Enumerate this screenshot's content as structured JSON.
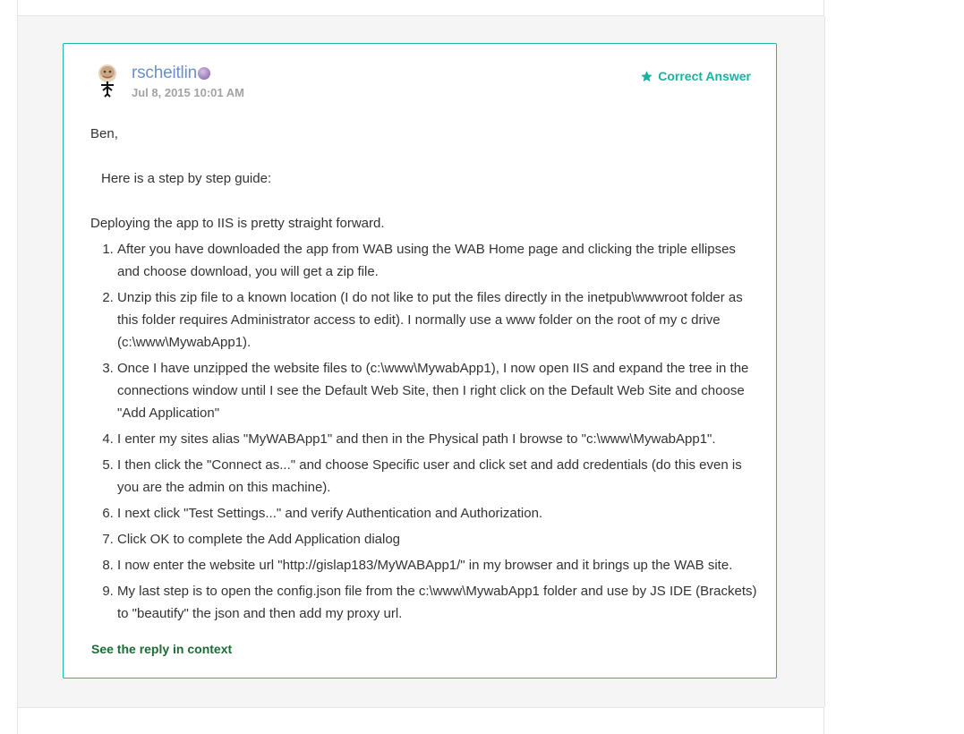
{
  "post": {
    "author": "rscheitlin",
    "date": "Jul 8, 2015 10:01 AM",
    "badge_label": "Correct Answer",
    "greeting": "Ben,",
    "intro": "Here is a step by step guide:",
    "deploy_line": "Deploying the app to IIS is pretty straight forward.",
    "steps": [
      "After you have downloaded the app from WAB using the WAB Home page and clicking the triple ellipses and choose download, you will get a zip file.",
      "Unzip this zip file to a known location (I do not like to put the files directly in the inetpub\\wwwroot folder as this folder requires Administrator access to edit). I normally use a www folder on the root of my c drive (c:\\www\\MywabApp1).",
      "Once I have unzipped the website files to (c:\\www\\MywabApp1), I now open IIS and expand the tree in the connections window until I see the Default Web Site, then I right click on the Default Web Site and choose \"Add Application\"",
      "I enter my sites alias \"MyWABApp1\" and then in the Physical path I browse to \"c:\\www\\MywabApp1\".",
      "I then click the \"Connect as...\" and choose Specific user and click set and add credentials (do this even is you are the admin on this machine).",
      "I next click \"Test Settings...\" and verify Authentication and Authorization.",
      "Click OK to complete the Add Application dialog",
      "I now enter the website url \"http://gislap183/MyWABApp1/\" in my browser and it brings up the WAB site.",
      "My last step is to open the config.json file from the c:\\www\\MywabApp1 folder and use by JS IDE (Brackets) to \"beautify\" the json and then add my proxy url."
    ],
    "context_link": "See the reply in context"
  },
  "colors": {
    "card_border": "#1fb5ac",
    "correct_answer": "#17b3a0",
    "author": "#6b8fc9",
    "context_link": "#1e6b36",
    "panel_bg": "#f5f5f5"
  },
  "icons": {
    "avatar": "user-avatar",
    "rank": "rank-badge-icon",
    "correct": "star-icon"
  }
}
